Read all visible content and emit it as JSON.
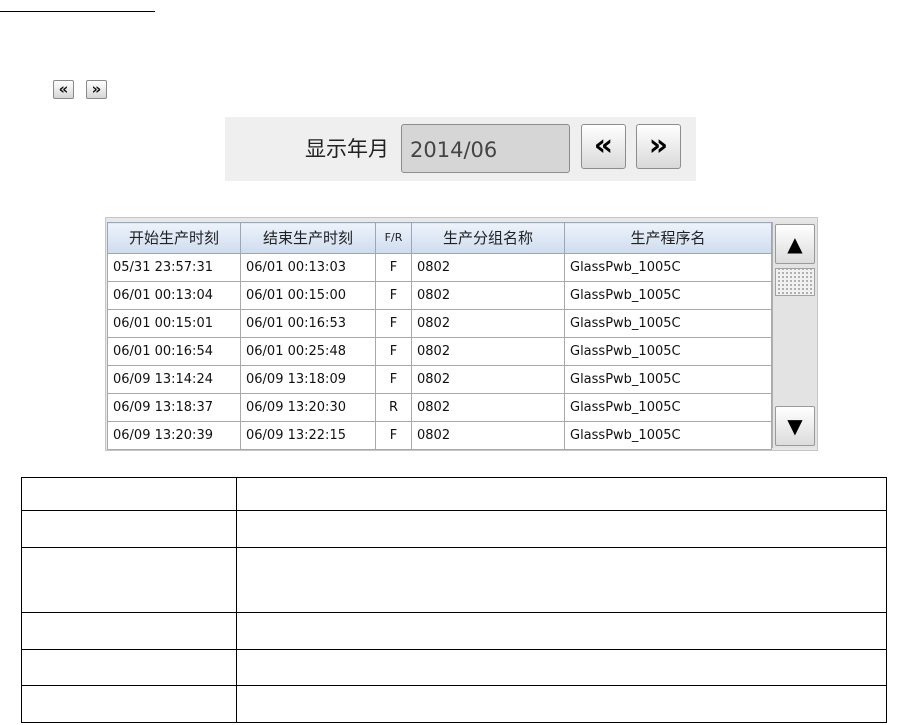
{
  "nav_mini": {
    "prev_label": "«",
    "next_label": "»"
  },
  "panel": {
    "label": "显示年月",
    "value": "2014/06",
    "prev_label": "«",
    "next_label": "»"
  },
  "log": {
    "columns": [
      "开始生产时刻",
      "结束生产时刻",
      "F/R",
      "生产分组名称",
      "生产程序名"
    ],
    "rows": [
      [
        "05/31 23:57:31",
        "06/01 00:13:03",
        "F",
        "0802",
        "GlassPwb_1005C"
      ],
      [
        "06/01 00:13:04",
        "06/01 00:15:00",
        "F",
        "0802",
        "GlassPwb_1005C"
      ],
      [
        "06/01 00:15:01",
        "06/01 00:16:53",
        "F",
        "0802",
        "GlassPwb_1005C"
      ],
      [
        "06/01 00:16:54",
        "06/01 00:25:48",
        "F",
        "0802",
        "GlassPwb_1005C"
      ],
      [
        "06/09 13:14:24",
        "06/09 13:18:09",
        "F",
        "0802",
        "GlassPwb_1005C"
      ],
      [
        "06/09 13:18:37",
        "06/09 13:20:30",
        "R",
        "0802",
        "GlassPwb_1005C"
      ],
      [
        "06/09 13:20:39",
        "06/09 13:22:15",
        "F",
        "0802",
        "GlassPwb_1005C"
      ]
    ]
  },
  "scrollbar": {
    "up_icon": "▲",
    "down_icon": "▼"
  }
}
